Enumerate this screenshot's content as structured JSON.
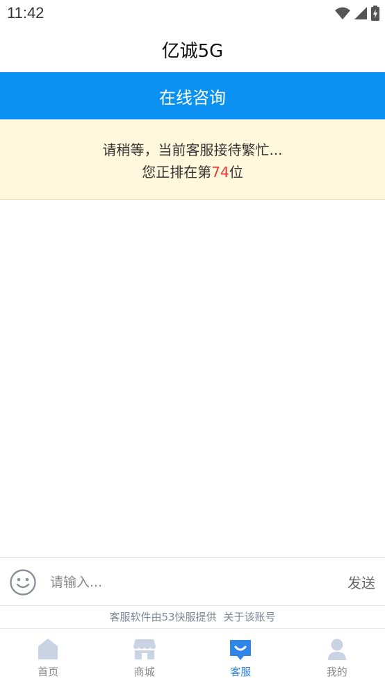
{
  "status_bar": {
    "time": "11:42"
  },
  "app": {
    "title": "亿诚5G"
  },
  "chat": {
    "title": "在线咨询"
  },
  "queue": {
    "line1": "请稍等，当前客服接待繁忙...",
    "line2_prefix": "您正排在第",
    "position": "74",
    "line2_suffix": "位"
  },
  "input": {
    "placeholder": "请输入...",
    "send_label": "发送"
  },
  "credits": {
    "powered_by": "客服软件由53快服提供",
    "about_account": "关于该账号"
  },
  "tabs": [
    {
      "label": "首页",
      "icon": "home-icon",
      "active": false
    },
    {
      "label": "商城",
      "icon": "store-icon",
      "active": false
    },
    {
      "label": "客服",
      "icon": "customer-service-icon",
      "active": true
    },
    {
      "label": "我的",
      "icon": "profile-icon",
      "active": false
    }
  ],
  "colors": {
    "accent": "#0a91f2",
    "notice_bg": "#fff8dc",
    "queue_number": "#e53935",
    "tab_active": "#2f86e8",
    "tab_inactive": "#c9d3e3"
  }
}
